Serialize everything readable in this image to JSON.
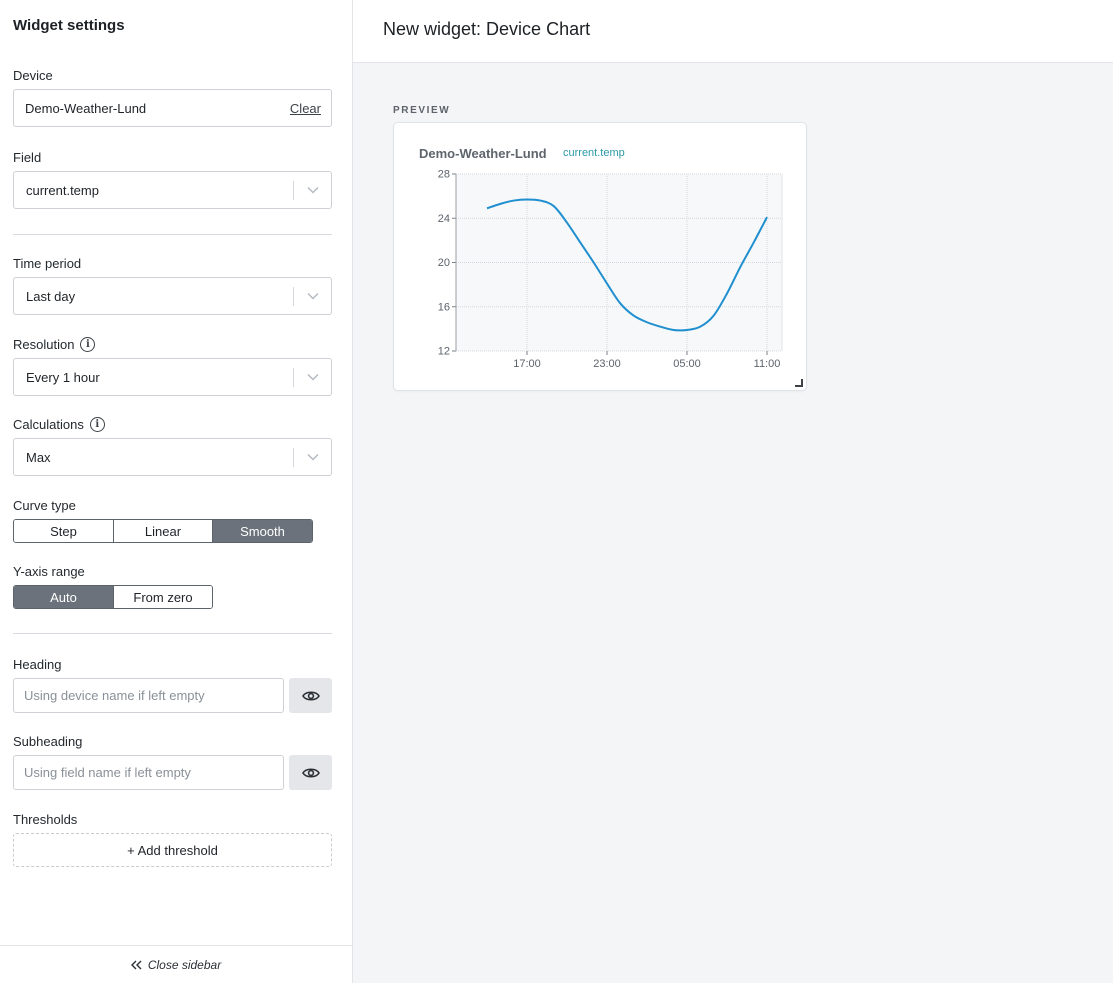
{
  "sidebar": {
    "title": "Widget settings",
    "device": {
      "label": "Device",
      "value": "Demo-Weather-Lund",
      "clear_label": "Clear"
    },
    "field": {
      "label": "Field",
      "value": "current.temp"
    },
    "time_period": {
      "label": "Time period",
      "value": "Last day"
    },
    "resolution": {
      "label": "Resolution",
      "value": "Every 1 hour",
      "info_icon": "info-icon"
    },
    "calculations": {
      "label": "Calculations",
      "value": "Max",
      "info_icon": "info-icon"
    },
    "curve_type": {
      "label": "Curve type",
      "options": [
        "Step",
        "Linear",
        "Smooth"
      ],
      "selected": "Smooth"
    },
    "y_axis_range": {
      "label": "Y-axis range",
      "options": [
        "Auto",
        "From zero"
      ],
      "selected": "Auto"
    },
    "heading": {
      "label": "Heading",
      "placeholder": "Using device name if left empty",
      "toggle_icon": "eye-icon"
    },
    "subheading": {
      "label": "Subheading",
      "placeholder": "Using field name if left empty",
      "toggle_icon": "eye-icon"
    },
    "thresholds": {
      "label": "Thresholds",
      "add_label": "+ Add threshold"
    },
    "footer": {
      "close_label": "Close sidebar",
      "icon": "double-chevron-left-icon"
    }
  },
  "main": {
    "title": "New widget: Device Chart",
    "preview_label": "PREVIEW",
    "card": {
      "heading": "Demo-Weather-Lund",
      "subheading": "current.temp"
    }
  },
  "colors": {
    "line": "#1f8fd0",
    "accent_sub": "#2b9aa8",
    "segment_active": "#6b727b"
  },
  "chart_data": {
    "type": "line",
    "curve": "smooth",
    "x_ticks": [
      "17:00",
      "23:00",
      "05:00",
      "11:00"
    ],
    "y_ticks": [
      12,
      16,
      20,
      24,
      28
    ],
    "ylim": [
      12,
      28
    ],
    "grid": true,
    "series": [
      {
        "x": [
          "14:00",
          "15:00",
          "16:00",
          "17:00",
          "18:00",
          "19:00",
          "20:00",
          "21:00",
          "22:00",
          "23:00",
          "00:00",
          "01:00",
          "02:00",
          "03:00",
          "04:00",
          "05:00",
          "06:00",
          "07:00",
          "08:00",
          "09:00",
          "10:00",
          "11:00"
        ],
        "values": [
          24.9,
          25.3,
          25.6,
          25.7,
          25.6,
          25.1,
          23.6,
          21.8,
          20.0,
          18.1,
          16.3,
          15.2,
          14.6,
          14.2,
          13.9,
          13.9,
          14.2,
          15.2,
          17.2,
          19.6,
          21.8,
          24.1
        ]
      }
    ]
  }
}
